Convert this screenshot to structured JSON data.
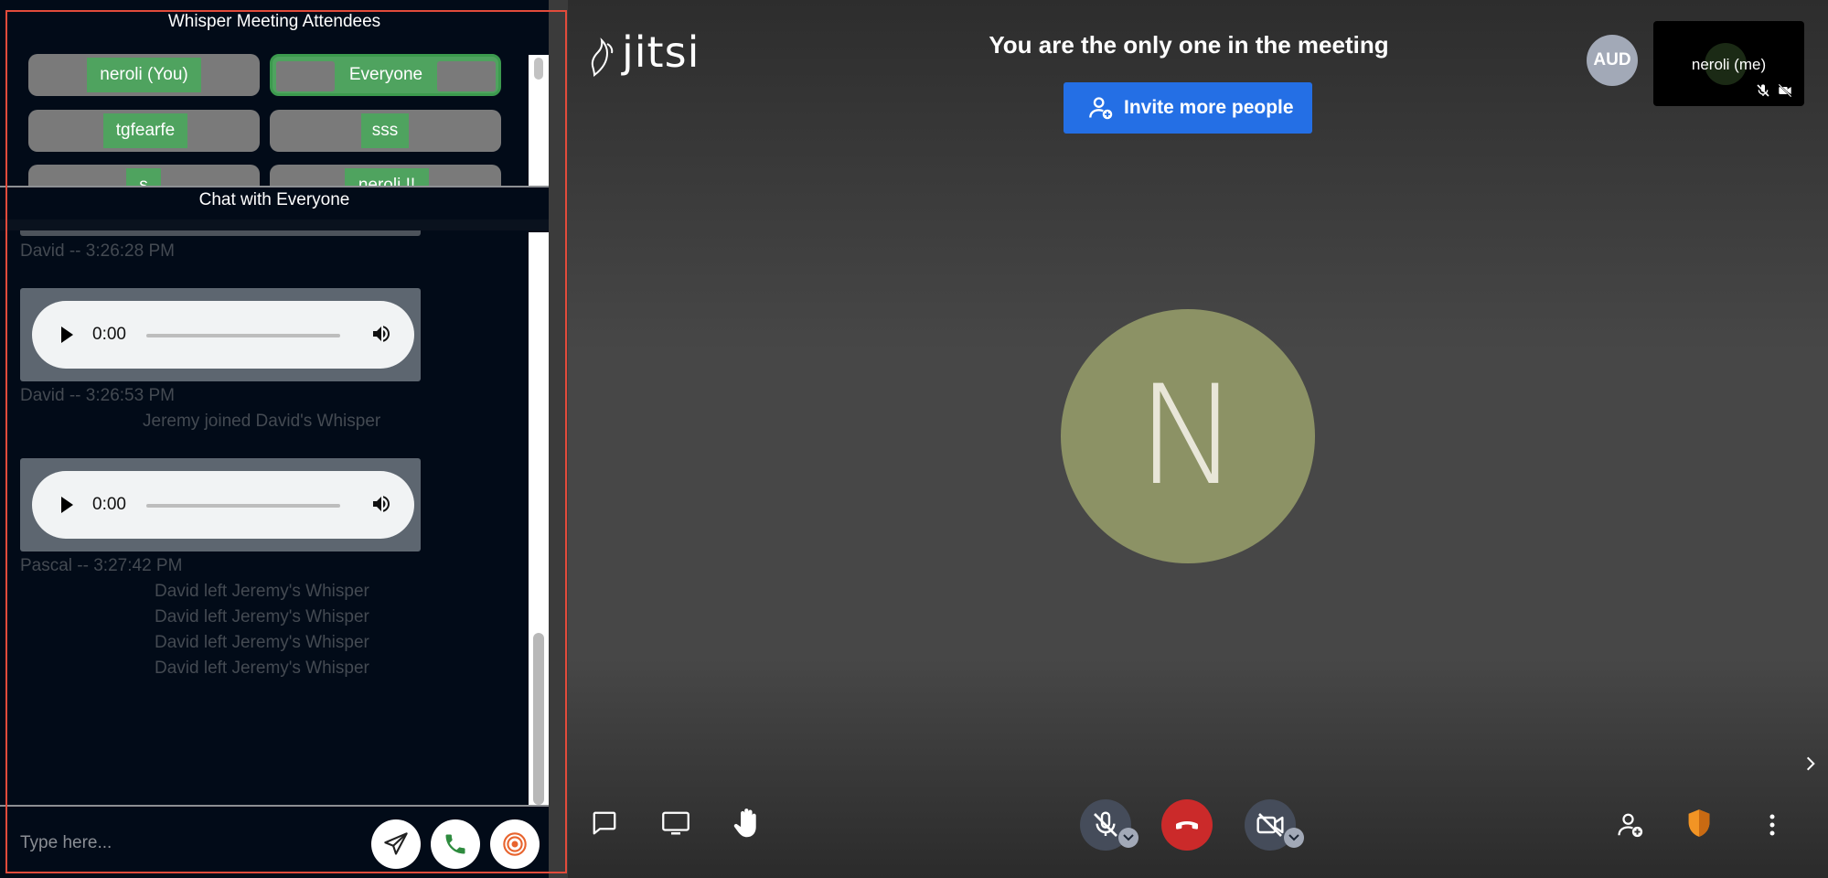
{
  "attendees_panel": {
    "title": "Whisper Meeting Attendees",
    "attendees": [
      {
        "label": "neroli (You)",
        "active": false
      },
      {
        "label": "Everyone",
        "active": true
      },
      {
        "label": "tgfearfe",
        "active": false
      },
      {
        "label": "sss",
        "active": false
      },
      {
        "label": "s",
        "active": false
      },
      {
        "label": "neroli !!",
        "active": false
      }
    ]
  },
  "chat_panel": {
    "title": "Chat with Everyone",
    "messages": [
      {
        "type": "meta",
        "text": "David -- 3:26:28 PM"
      },
      {
        "type": "audio",
        "time": "0:00"
      },
      {
        "type": "meta",
        "text": "David -- 3:26:53 PM"
      },
      {
        "type": "system",
        "text": "Jeremy joined David's Whisper"
      },
      {
        "type": "audio",
        "time": "0:00"
      },
      {
        "type": "meta",
        "text": "Pascal -- 3:27:42 PM"
      },
      {
        "type": "system",
        "text": "David left Jeremy's Whisper"
      },
      {
        "type": "system",
        "text": "David left Jeremy's Whisper"
      },
      {
        "type": "system",
        "text": "David left Jeremy's Whisper"
      },
      {
        "type": "system",
        "text": "David left Jeremy's Whisper"
      }
    ],
    "input_placeholder": "Type here...",
    "buttons": {
      "send": "send-icon",
      "call": "phone-icon",
      "whisper": "target-icon"
    }
  },
  "stage": {
    "logo_text": "jitsi",
    "meeting_message": "You are the only one in the meeting",
    "invite_button": "Invite more people",
    "audio_badge": "AUD",
    "self_view_name": "neroli (me)",
    "participant_initial": "N",
    "colors": {
      "invite_button": "#246fe5",
      "hangup": "#cb2a2a",
      "avatar": "#8c9265",
      "attendee_green": "#4fa35f",
      "panel_border": "#e24b3b"
    }
  },
  "toolbar": {
    "left": [
      "chat-icon",
      "screen-share-icon",
      "raise-hand-icon"
    ],
    "center": [
      "mic-off-icon",
      "hangup-icon",
      "camera-off-icon"
    ],
    "right": [
      "invite-icon",
      "security-shield-icon",
      "more-options-icon"
    ]
  }
}
